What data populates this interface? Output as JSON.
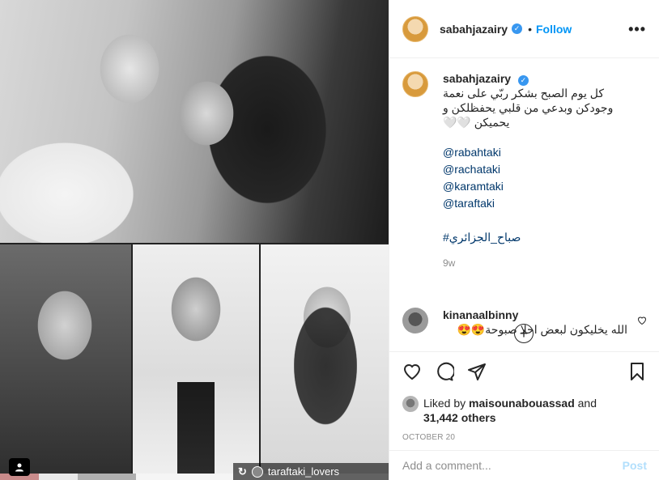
{
  "post": {
    "author": "sabahjazairy",
    "follow_label": "Follow",
    "dot": "•",
    "more_icon": "more-options-icon"
  },
  "caption": {
    "username": "sabahjazairy",
    "text": "كل يوم الصبح بشكر ربّي على نعمة وجودكن وبدعي من قلبي يحفظلكن و يحميكن 🤍🤍",
    "mentions": [
      "@rabahtaki",
      "@rachataki",
      "@karamtaki",
      "@taraftaki"
    ],
    "hashtag": "#صباح_الجزائري",
    "time": "9w"
  },
  "comment": {
    "username": "kinanaalbinny",
    "text": "الله يخليكون لبعض احلا صبوحة😍😍"
  },
  "likes": {
    "prefix": "Liked by ",
    "user": "maisounabouassad",
    "middle": " and",
    "count": "31,442 others"
  },
  "date": "OCTOBER 20",
  "add_comment": {
    "placeholder": "Add a comment...",
    "post_label": "Post"
  },
  "media": {
    "watermark": "taraftaki_lovers",
    "repost_icon": "↻"
  }
}
